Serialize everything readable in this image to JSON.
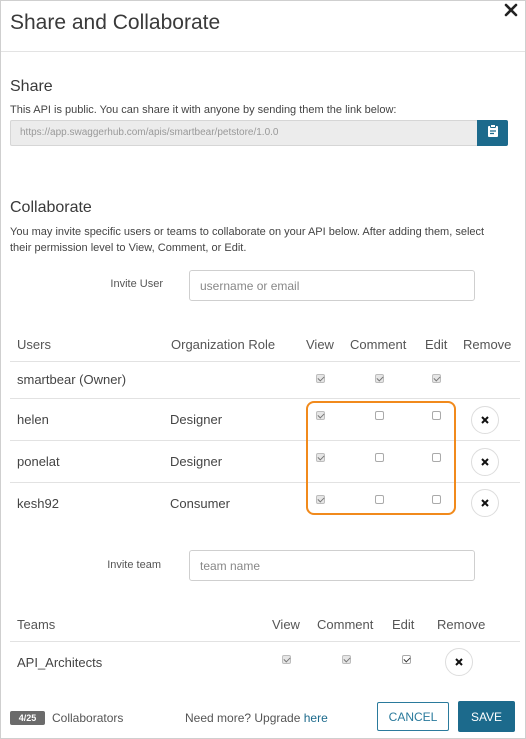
{
  "dialog": {
    "title": "Share and Collaborate"
  },
  "share": {
    "title": "Share",
    "description": "This API is public. You can share it with anyone by sending them the link below:",
    "link": "https://app.swaggerhub.com/apis/smartbear/petstore/1.0.0"
  },
  "collaborate": {
    "title": "Collaborate",
    "description_line1": "You may invite specific users or teams to collaborate on your API below. After adding them, select",
    "description_line2": "their permission level to View, Comment, or Edit.",
    "invite_user_label": "Invite User",
    "invite_user_placeholder": "username or email",
    "invite_team_label": "Invite team",
    "invite_team_placeholder": "team name"
  },
  "users_table": {
    "headers": {
      "users": "Users",
      "org_role": "Organization Role",
      "view": "View",
      "comment": "Comment",
      "edit": "Edit",
      "remove": "Remove"
    },
    "rows": [
      {
        "name": "smartbear (Owner)",
        "role": "",
        "view": true,
        "comment": true,
        "edit": true,
        "editable": false,
        "removable": false
      },
      {
        "name": "helen",
        "role": "Designer",
        "view": true,
        "comment": false,
        "edit": false,
        "editable": true,
        "removable": true
      },
      {
        "name": "ponelat",
        "role": "Designer",
        "view": true,
        "comment": false,
        "edit": false,
        "editable": true,
        "removable": true
      },
      {
        "name": "kesh92",
        "role": "Consumer",
        "view": true,
        "comment": false,
        "edit": false,
        "editable": true,
        "removable": true
      }
    ]
  },
  "teams_table": {
    "headers": {
      "teams": "Teams",
      "view": "View",
      "comment": "Comment",
      "edit": "Edit",
      "remove": "Remove"
    },
    "rows": [
      {
        "name": "API_Architects",
        "view": true,
        "comment": true,
        "edit": true
      }
    ]
  },
  "footer": {
    "count": "4/25",
    "collaborators_label": "Collaborators",
    "need_more": "Need more? Upgrade",
    "upgrade_link": "here",
    "cancel_label": "CANCEL",
    "save_label": "SAVE"
  },
  "colors": {
    "accent": "#1c6a8c",
    "highlight": "#f18a1c"
  },
  "icons": {
    "close": "close-icon",
    "copy": "clipboard-icon",
    "remove": "x-icon"
  }
}
